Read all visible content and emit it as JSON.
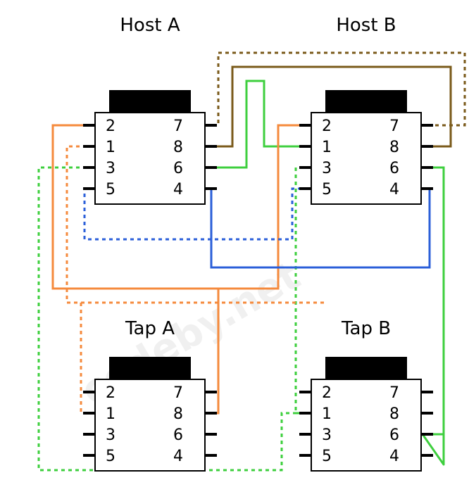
{
  "hostA": {
    "label": "Host A",
    "pins_left": [
      "2",
      "1",
      "3",
      "5"
    ],
    "pins_right": [
      "7",
      "8",
      "6",
      "4"
    ]
  },
  "hostB": {
    "label": "Host B",
    "pins_left": [
      "2",
      "1",
      "3",
      "5"
    ],
    "pins_right": [
      "7",
      "8",
      "6",
      "4"
    ]
  },
  "tapA": {
    "label": "Tap A",
    "pins_left": [
      "2",
      "1",
      "3",
      "5"
    ],
    "pins_right": [
      "7",
      "8",
      "6",
      "4"
    ]
  },
  "tapB": {
    "label": "Tap B",
    "pins_left": [
      "2",
      "1",
      "3",
      "5"
    ],
    "pins_right": [
      "7",
      "8",
      "6",
      "4"
    ]
  },
  "colors": {
    "green": "#3ecf3e",
    "green_d": "#3ecf3e",
    "orange": "#f58a3c",
    "orange_d": "#f58a3c",
    "brown": "#7a5a1a",
    "brown_d": "#7a5a1a",
    "blue": "#2b5fd9",
    "blue_d": "#2b5fd9"
  },
  "watermark": "codeby.net"
}
